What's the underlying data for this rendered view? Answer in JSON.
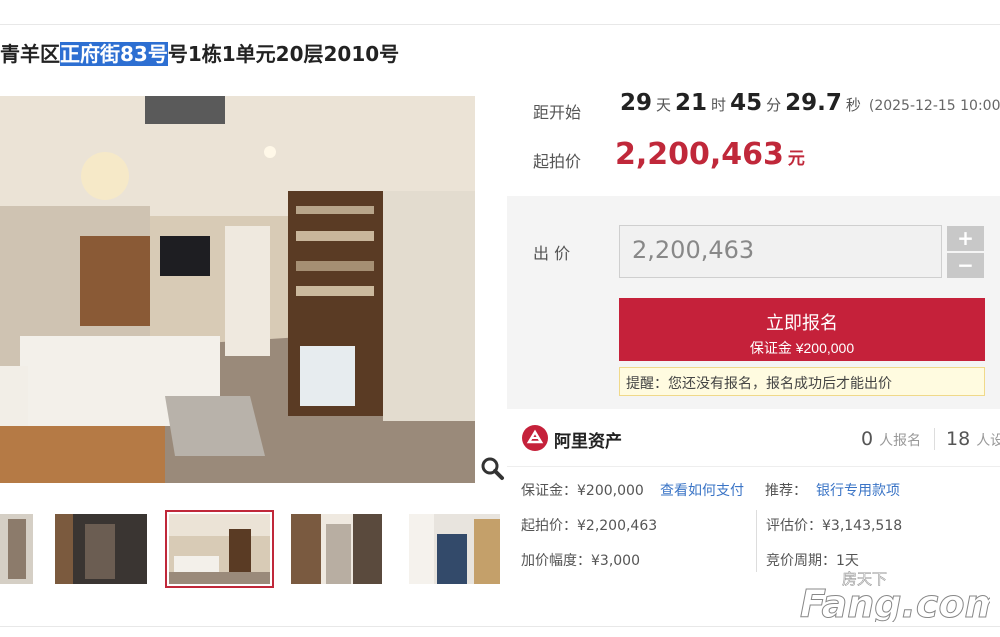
{
  "title": {
    "prefix": "青羊区",
    "highlight": "正府街83号",
    "suffix": "号1栋1单元20层2010号"
  },
  "countdown": {
    "label": "距开始",
    "days": "29",
    "days_unit": "天",
    "hours": "21",
    "hours_unit": "时",
    "minutes": "45",
    "minutes_unit": "分",
    "seconds": "29.7",
    "seconds_unit": "秒",
    "start_time": "(2025-12-15 10:00"
  },
  "start_price": {
    "label": "起拍价",
    "value": "2,200,463",
    "unit": "元"
  },
  "bid": {
    "label": "出  价",
    "value": "2,200,463",
    "plus": "+",
    "minus": "−",
    "apply_label": "立即报名",
    "deposit_label": "保证金 ¥200,000",
    "tip": "提醒：您还没有报名，报名成功后才能出价"
  },
  "platform": {
    "name": "阿里资产",
    "signup_count": "0",
    "signup_label": "人报名",
    "watch_count": "18",
    "watch_label": "人设"
  },
  "details": {
    "deposit": "保证金：¥200,000",
    "how_to_pay": "查看如何支付",
    "recommend_label": "推荐：",
    "bank_account": "银行专用款项",
    "start_price": "起拍价：¥2,200,463",
    "appraisal": "评估价：¥3,143,518",
    "increment": "加价幅度：¥3,000",
    "period": "竞价周期：1天"
  },
  "watermark": {
    "text": "房天下",
    "brand": "Fang.com"
  },
  "colors": {
    "accent": "#c5213a",
    "price": "#c0283a",
    "link": "#3a74c6",
    "highlight": "#2d6fd2"
  },
  "icons": [
    "zoom-icon",
    "ali-asset-logo",
    "plus-icon",
    "minus-icon"
  ]
}
